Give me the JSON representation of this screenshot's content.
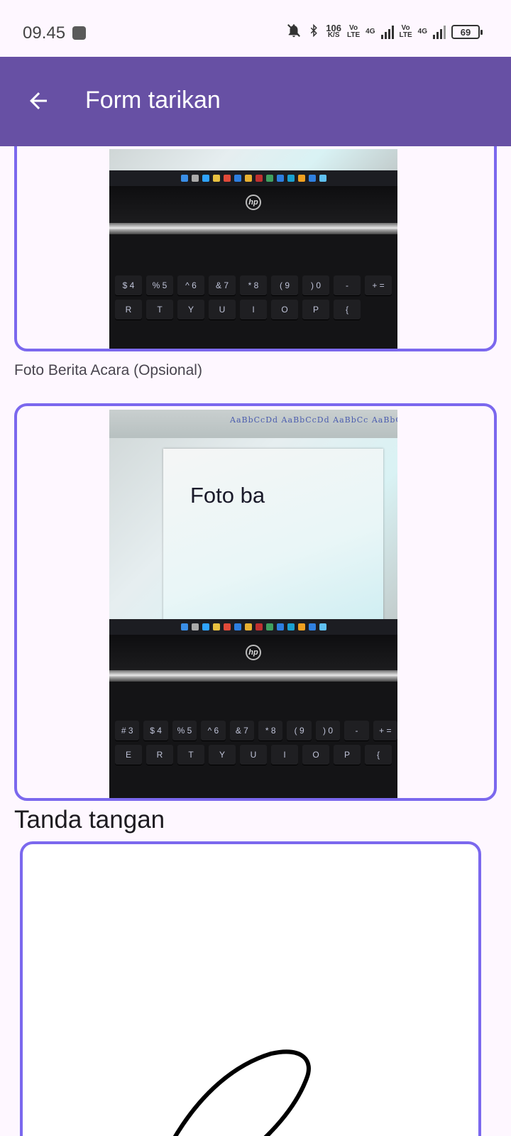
{
  "status_bar": {
    "time": "09.45",
    "speed_value": "106",
    "speed_unit": "K/S",
    "sim1_volte_top": "Vo",
    "sim1_volte_bottom": "LTE",
    "sim1_network": "4G",
    "sim2_volte_top": "Vo",
    "sim2_volte_bottom": "LTE",
    "sim2_network": "4G",
    "battery_level": "69",
    "icons": [
      "notifications-off-icon",
      "bluetooth-icon"
    ]
  },
  "app_bar": {
    "title": "Form tarikan",
    "back_icon": "arrow-back-icon",
    "background_color": "#6750A4"
  },
  "photo_top": {
    "keys_row1": [
      "$",
      "%",
      "^",
      "&",
      "*",
      "(",
      ")",
      "-",
      "+"
    ],
    "keys_row1_sub": [
      "4",
      "5",
      "6",
      "7",
      "8",
      "9",
      "0",
      "",
      "="
    ],
    "keys_row2": [
      "R",
      "T",
      "Y",
      "U",
      "I",
      "O",
      "P",
      "{"
    ]
  },
  "photo_ba_section": {
    "label": "Foto Berita Acara (Opsional)",
    "ribbon_text": "AaBbCcDd AaBbCcDd AaBbCc AaBbCcC",
    "ribbon_big": "AaB",
    "document_text": "Foto ba",
    "keys_row1": [
      "#",
      "$",
      "%",
      "^",
      "&",
      "*",
      "(",
      ")",
      "-",
      "+"
    ],
    "keys_row1_sub": [
      "3",
      "4",
      "5",
      "6",
      "7",
      "8",
      "9",
      "0",
      "",
      "="
    ],
    "keys_row2": [
      "E",
      "R",
      "T",
      "Y",
      "U",
      "I",
      "O",
      "P",
      "{"
    ]
  },
  "signature_section": {
    "heading": "Tanda tangan"
  },
  "colors": {
    "accent_border": "#7B68EE",
    "background": "#FEF7FF"
  }
}
